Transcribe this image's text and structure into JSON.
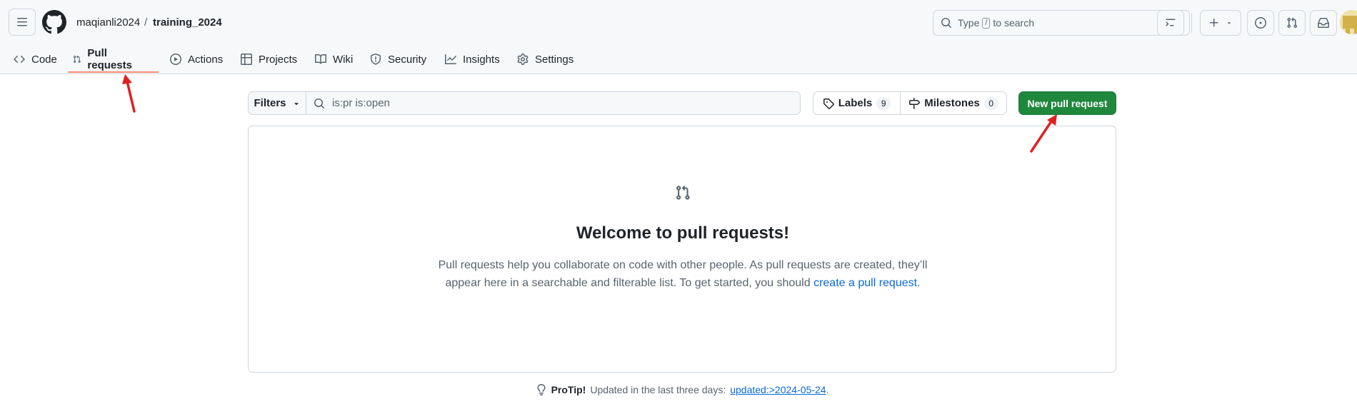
{
  "header": {
    "owner": "maqianli2024",
    "separator": "/",
    "repo": "training_2024",
    "search": {
      "prefix": "Type",
      "key": "/",
      "suffix": "to search"
    }
  },
  "tabs": [
    {
      "label": "Code",
      "icon": "code-icon"
    },
    {
      "label": "Pull requests",
      "icon": "git-pull-request-icon",
      "active": true
    },
    {
      "label": "Actions",
      "icon": "play-icon"
    },
    {
      "label": "Projects",
      "icon": "table-icon"
    },
    {
      "label": "Wiki",
      "icon": "book-icon"
    },
    {
      "label": "Security",
      "icon": "shield-icon"
    },
    {
      "label": "Insights",
      "icon": "graph-icon"
    },
    {
      "label": "Settings",
      "icon": "gear-icon"
    }
  ],
  "toolbar": {
    "filters_label": "Filters",
    "filter_value": "is:pr is:open",
    "labels_label": "Labels",
    "labels_count": "9",
    "milestones_label": "Milestones",
    "milestones_count": "0",
    "new_pr_label": "New pull request"
  },
  "blankslate": {
    "title": "Welcome to pull requests!",
    "text_before_link": "Pull requests help you collaborate on code with other people. As pull requests are created, they’ll appear here in a searchable and filterable list. To get started, you should ",
    "link_text": "create a pull request",
    "text_after_link": "."
  },
  "protip": {
    "label": "ProTip!",
    "text": "Updated in the last three days:",
    "link": "updated:>2024-05-24",
    "end": "."
  },
  "colors": {
    "primary_button": "#1f883d",
    "active_tab_underline": "#fd8c73",
    "link": "#0969da",
    "annotation_arrow": "#e02020"
  }
}
